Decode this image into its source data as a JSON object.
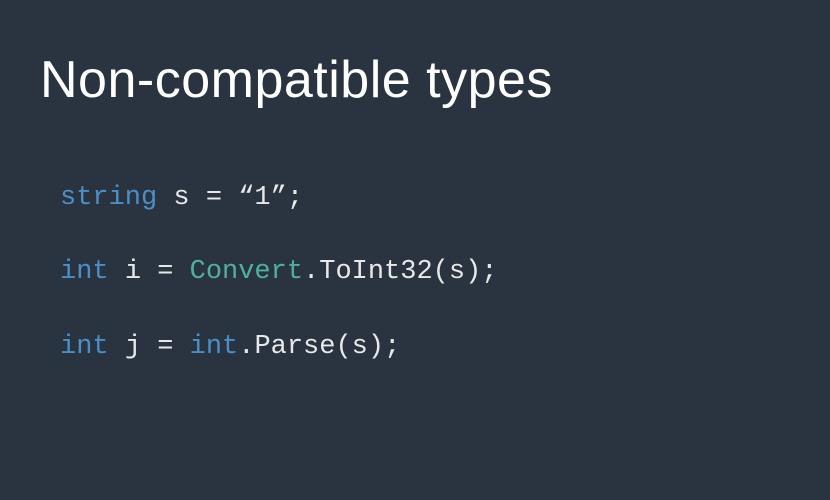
{
  "slide": {
    "title": "Non-compatible types",
    "code": {
      "line1": {
        "kw": "string",
        "sp1": " ",
        "id": "s",
        "sp2": " ",
        "eq": "=",
        "sp3": " ",
        "str": "“1”",
        "semi": ";"
      },
      "line2": {
        "kw": "int",
        "sp1": " ",
        "id": "i",
        "sp2": " ",
        "eq": "=",
        "sp3": " ",
        "type": "Convert",
        "dot": ".",
        "method": "ToInt32",
        "lpar": "(",
        "arg": "s",
        "rpar": ")",
        "semi": ";"
      },
      "line3": {
        "kw": "int",
        "sp1": " ",
        "id": "j",
        "sp2": " ",
        "eq": "=",
        "sp3": " ",
        "type": "int",
        "dot": ".",
        "method": "Parse",
        "lpar": "(",
        "arg": "s",
        "rpar": ")",
        "semi": ";"
      }
    }
  }
}
